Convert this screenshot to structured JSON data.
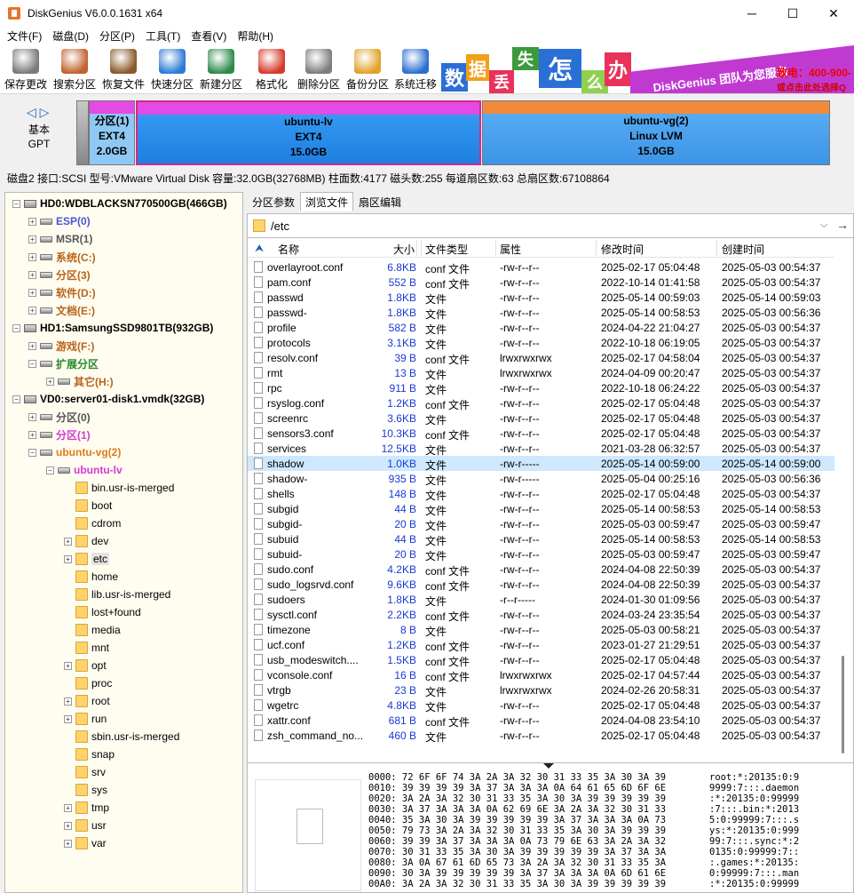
{
  "window": {
    "title": "DiskGenius V6.0.0.1631 x64",
    "min": "─",
    "max": "☐",
    "close": "✕"
  },
  "menu": [
    "文件(F)",
    "磁盘(D)",
    "分区(P)",
    "工具(T)",
    "查看(V)",
    "帮助(H)"
  ],
  "toolbar": [
    {
      "label": "保存更改",
      "icon": "save-icon",
      "color": "#7a7a7a"
    },
    {
      "label": "搜索分区",
      "icon": "search-icon",
      "color": "#c0632c"
    },
    {
      "label": "恢复文件",
      "icon": "recover-icon",
      "color": "#8a5a2b"
    },
    {
      "label": "快速分区",
      "icon": "quick-partition-icon",
      "color": "#2d7bd6"
    },
    {
      "label": "新建分区",
      "icon": "new-partition-icon",
      "color": "#2f8a4b"
    },
    {
      "label": "格式化",
      "icon": "format-icon",
      "color": "#d63b2b"
    },
    {
      "label": "删除分区",
      "icon": "delete-icon",
      "color": "#7d7d7d"
    },
    {
      "label": "备份分区",
      "icon": "backup-icon",
      "color": "#e2a12a"
    },
    {
      "label": "系统迁移",
      "icon": "migrate-icon",
      "color": "#2b6fd1"
    }
  ],
  "banner": {
    "tiles": [
      "数",
      "据",
      "丢",
      "失",
      "怎",
      "么",
      "办"
    ],
    "slogan": "DiskGenius 团队为您服务",
    "phone": "致电：400-900-",
    "sub": "或点击此处选择Q"
  },
  "diskmap": {
    "nav": "◁ ▷",
    "type1": "基本",
    "type2": "GPT",
    "partitions": [
      {
        "name": "分区(1)",
        "fs": "EXT4",
        "size": "2.0GB"
      },
      {
        "name": "ubuntu-lv",
        "fs": "EXT4",
        "size": "15.0GB"
      },
      {
        "name": "ubuntu-vg(2)",
        "fs": "Linux LVM",
        "size": "15.0GB"
      }
    ]
  },
  "diskinfo": "磁盘2 接口:SCSI  型号:VMware Virtual Disk  容量:32.0GB(32768MB)  柱面数:4177  磁头数:255  每道扇区数:63  总扇区数:67108864",
  "tree": [
    {
      "label": "HD0:WDBLACKSN770500GB(466GB)",
      "color": "#000",
      "bold": true,
      "kind": "disk"
    },
    {
      "label": "ESP(0)",
      "color": "#4a55d8",
      "bold": true,
      "kind": "drv"
    },
    {
      "label": "MSR(1)",
      "color": "#555555",
      "bold": true,
      "kind": "drv"
    },
    {
      "label": "系统(C:)",
      "color": "#b8641a",
      "bold": true,
      "kind": "drv"
    },
    {
      "label": "分区(3)",
      "color": "#b8641a",
      "bold": true,
      "kind": "drv"
    },
    {
      "label": "软件(D:)",
      "color": "#b8641a",
      "bold": true,
      "kind": "drv"
    },
    {
      "label": "文档(E:)",
      "color": "#b8641a",
      "bold": true,
      "kind": "drv"
    },
    {
      "label": "HD1:SamsungSSD9801TB(932GB)",
      "color": "#000",
      "bold": true,
      "kind": "disk"
    },
    {
      "label": "游戏(F:)",
      "color": "#b8641a",
      "bold": true,
      "kind": "drv"
    },
    {
      "label": "扩展分区",
      "color": "#2a8a2a",
      "bold": true,
      "kind": "drv"
    },
    {
      "label": "其它(H:)",
      "color": "#b8641a",
      "bold": true,
      "kind": "drv"
    },
    {
      "label": "VD0:server01-disk1.vmdk(32GB)",
      "color": "#000",
      "bold": true,
      "kind": "disk"
    },
    {
      "label": "分区(0)",
      "color": "#555555",
      "bold": true,
      "kind": "drv"
    },
    {
      "label": "分区(1)",
      "color": "#d33bd3",
      "bold": true,
      "kind": "drv"
    },
    {
      "label": "ubuntu-vg(2)",
      "color": "#e07a1a",
      "bold": true,
      "kind": "drv"
    },
    {
      "label": "ubuntu-lv",
      "color": "#d33bd3",
      "bold": true,
      "kind": "drv"
    },
    {
      "label": "bin.usr-is-merged",
      "color": "#000",
      "bold": false,
      "kind": "folder"
    },
    {
      "label": "boot",
      "color": "#000",
      "bold": false,
      "kind": "folder"
    },
    {
      "label": "cdrom",
      "color": "#000",
      "bold": false,
      "kind": "folder"
    },
    {
      "label": "dev",
      "color": "#000",
      "bold": false,
      "kind": "folder"
    },
    {
      "label": "etc",
      "color": "#000",
      "bold": false,
      "kind": "folder"
    },
    {
      "label": "home",
      "color": "#000",
      "bold": false,
      "kind": "folder"
    },
    {
      "label": "lib.usr-is-merged",
      "color": "#000",
      "bold": false,
      "kind": "folder"
    },
    {
      "label": "lost+found",
      "color": "#000",
      "bold": false,
      "kind": "folder"
    },
    {
      "label": "media",
      "color": "#000",
      "bold": false,
      "kind": "folder"
    },
    {
      "label": "mnt",
      "color": "#000",
      "bold": false,
      "kind": "folder"
    },
    {
      "label": "opt",
      "color": "#000",
      "bold": false,
      "kind": "folder"
    },
    {
      "label": "proc",
      "color": "#000",
      "bold": false,
      "kind": "folder"
    },
    {
      "label": "root",
      "color": "#000",
      "bold": false,
      "kind": "folder"
    },
    {
      "label": "run",
      "color": "#000",
      "bold": false,
      "kind": "folder"
    },
    {
      "label": "sbin.usr-is-merged",
      "color": "#000",
      "bold": false,
      "kind": "folder"
    },
    {
      "label": "snap",
      "color": "#000",
      "bold": false,
      "kind": "folder"
    },
    {
      "label": "srv",
      "color": "#000",
      "bold": false,
      "kind": "folder"
    },
    {
      "label": "sys",
      "color": "#000",
      "bold": false,
      "kind": "folder"
    },
    {
      "label": "tmp",
      "color": "#000",
      "bold": false,
      "kind": "folder"
    },
    {
      "label": "usr",
      "color": "#000",
      "bold": false,
      "kind": "folder"
    },
    {
      "label": "var",
      "color": "#000",
      "bold": false,
      "kind": "folder"
    }
  ],
  "tabs": [
    "分区参数",
    "浏览文件",
    "扇区编辑"
  ],
  "path": "/etc",
  "columns": [
    "名称",
    "大小",
    "文件类型",
    "属性",
    "修改时间",
    "创建时间"
  ],
  "files": [
    [
      "overlayroot.conf",
      "6.8KB",
      "conf 文件",
      "-rw-r--r--",
      "2025-02-17 05:04:48",
      "2025-05-03 00:54:37"
    ],
    [
      "pam.conf",
      "552 B",
      "conf 文件",
      "-rw-r--r--",
      "2022-10-14 01:41:58",
      "2025-05-03 00:54:37"
    ],
    [
      "passwd",
      "1.8KB",
      "文件",
      "-rw-r--r--",
      "2025-05-14 00:59:03",
      "2025-05-14 00:59:03"
    ],
    [
      "passwd-",
      "1.8KB",
      "文件",
      "-rw-r--r--",
      "2025-05-14 00:58:53",
      "2025-05-03 00:56:36"
    ],
    [
      "profile",
      "582 B",
      "文件",
      "-rw-r--r--",
      "2024-04-22 21:04:27",
      "2025-05-03 00:54:37"
    ],
    [
      "protocols",
      "3.1KB",
      "文件",
      "-rw-r--r--",
      "2022-10-18 06:19:05",
      "2025-05-03 00:54:37"
    ],
    [
      "resolv.conf",
      "39 B",
      "conf 文件",
      "lrwxrwxrwx",
      "2025-02-17 04:58:04",
      "2025-05-03 00:54:37"
    ],
    [
      "rmt",
      "13 B",
      "文件",
      "lrwxrwxrwx",
      "2024-04-09 00:20:47",
      "2025-05-03 00:54:37"
    ],
    [
      "rpc",
      "911 B",
      "文件",
      "-rw-r--r--",
      "2022-10-18 06:24:22",
      "2025-05-03 00:54:37"
    ],
    [
      "rsyslog.conf",
      "1.2KB",
      "conf 文件",
      "-rw-r--r--",
      "2025-02-17 05:04:48",
      "2025-05-03 00:54:37"
    ],
    [
      "screenrc",
      "3.6KB",
      "文件",
      "-rw-r--r--",
      "2025-02-17 05:04:48",
      "2025-05-03 00:54:37"
    ],
    [
      "sensors3.conf",
      "10.3KB",
      "conf 文件",
      "-rw-r--r--",
      "2025-02-17 05:04:48",
      "2025-05-03 00:54:37"
    ],
    [
      "services",
      "12.5KB",
      "文件",
      "-rw-r--r--",
      "2021-03-28 06:32:57",
      "2025-05-03 00:54:37"
    ],
    [
      "shadow",
      "1.0KB",
      "文件",
      "-rw-r-----",
      "2025-05-14 00:59:00",
      "2025-05-14 00:59:00"
    ],
    [
      "shadow-",
      "935 B",
      "文件",
      "-rw-r-----",
      "2025-05-04 00:25:16",
      "2025-05-03 00:56:36"
    ],
    [
      "shells",
      "148 B",
      "文件",
      "-rw-r--r--",
      "2025-02-17 05:04:48",
      "2025-05-03 00:54:37"
    ],
    [
      "subgid",
      "44 B",
      "文件",
      "-rw-r--r--",
      "2025-05-14 00:58:53",
      "2025-05-14 00:58:53"
    ],
    [
      "subgid-",
      "20 B",
      "文件",
      "-rw-r--r--",
      "2025-05-03 00:59:47",
      "2025-05-03 00:59:47"
    ],
    [
      "subuid",
      "44 B",
      "文件",
      "-rw-r--r--",
      "2025-05-14 00:58:53",
      "2025-05-14 00:58:53"
    ],
    [
      "subuid-",
      "20 B",
      "文件",
      "-rw-r--r--",
      "2025-05-03 00:59:47",
      "2025-05-03 00:59:47"
    ],
    [
      "sudo.conf",
      "4.2KB",
      "conf 文件",
      "-rw-r--r--",
      "2024-04-08 22:50:39",
      "2025-05-03 00:54:37"
    ],
    [
      "sudo_logsrvd.conf",
      "9.6KB",
      "conf 文件",
      "-rw-r--r--",
      "2024-04-08 22:50:39",
      "2025-05-03 00:54:37"
    ],
    [
      "sudoers",
      "1.8KB",
      "文件",
      "-r--r-----",
      "2024-01-30 01:09:56",
      "2025-05-03 00:54:37"
    ],
    [
      "sysctl.conf",
      "2.2KB",
      "conf 文件",
      "-rw-r--r--",
      "2024-03-24 23:35:54",
      "2025-05-03 00:54:37"
    ],
    [
      "timezone",
      "8 B",
      "文件",
      "-rw-r--r--",
      "2025-05-03 00:58:21",
      "2025-05-03 00:54:37"
    ],
    [
      "ucf.conf",
      "1.2KB",
      "conf 文件",
      "-rw-r--r--",
      "2023-01-27 21:29:51",
      "2025-05-03 00:54:37"
    ],
    [
      "usb_modeswitch....",
      "1.5KB",
      "conf 文件",
      "-rw-r--r--",
      "2025-02-17 05:04:48",
      "2025-05-03 00:54:37"
    ],
    [
      "vconsole.conf",
      "16 B",
      "conf 文件",
      "lrwxrwxrwx",
      "2025-02-17 04:57:44",
      "2025-05-03 00:54:37"
    ],
    [
      "vtrgb",
      "23 B",
      "文件",
      "lrwxrwxrwx",
      "2024-02-26 20:58:31",
      "2025-05-03 00:54:37"
    ],
    [
      "wgetrc",
      "4.8KB",
      "文件",
      "-rw-r--r--",
      "2025-02-17 05:04:48",
      "2025-05-03 00:54:37"
    ],
    [
      "xattr.conf",
      "681 B",
      "conf 文件",
      "-rw-r--r--",
      "2024-04-08 23:54:10",
      "2025-05-03 00:54:37"
    ],
    [
      "zsh_command_no...",
      "460 B",
      "文件",
      "-rw-r--r--",
      "2025-02-17 05:04:48",
      "2025-05-03 00:54:37"
    ]
  ],
  "selected_file": "shadow",
  "hex": {
    "lines": [
      "0000: 72 6F 6F 74 3A 2A 3A 32 30 31 33 35 3A 30 3A 39",
      "0010: 39 39 39 39 3A 37 3A 3A 3A 0A 64 61 65 6D 6F 6E",
      "0020: 3A 2A 3A 32 30 31 33 35 3A 30 3A 39 39 39 39 39",
      "0030: 3A 37 3A 3A 3A 0A 62 69 6E 3A 2A 3A 32 30 31 33",
      "0040: 35 3A 30 3A 39 39 39 39 39 3A 37 3A 3A 3A 0A 73",
      "0050: 79 73 3A 2A 3A 32 30 31 33 35 3A 30 3A 39 39 39",
      "0060: 39 39 3A 37 3A 3A 3A 0A 73 79 6E 63 3A 2A 3A 32",
      "0070: 30 31 33 35 3A 30 3A 39 39 39 39 39 3A 37 3A 3A",
      "0080: 3A 0A 67 61 6D 65 73 3A 2A 3A 32 30 31 33 35 3A",
      "0090: 30 3A 39 39 39 39 39 3A 37 3A 3A 3A 0A 6D 61 6E",
      "00A0: 3A 2A 3A 32 30 31 33 35 3A 30 3A 39 39 39 39 39"
    ],
    "ascii": [
      "root:*:20135:0:9",
      "9999:7:::.daemon",
      ":*:20135:0:99999",
      ":7:::.bin:*:2013",
      "5:0:99999:7:::.s",
      "ys:*:20135:0:999",
      "99:7:::.sync:*:2",
      "0135:0:99999:7::",
      ":.games:*:20135:",
      "0:99999:7:::.man",
      ":*:20135:0:99999"
    ]
  }
}
